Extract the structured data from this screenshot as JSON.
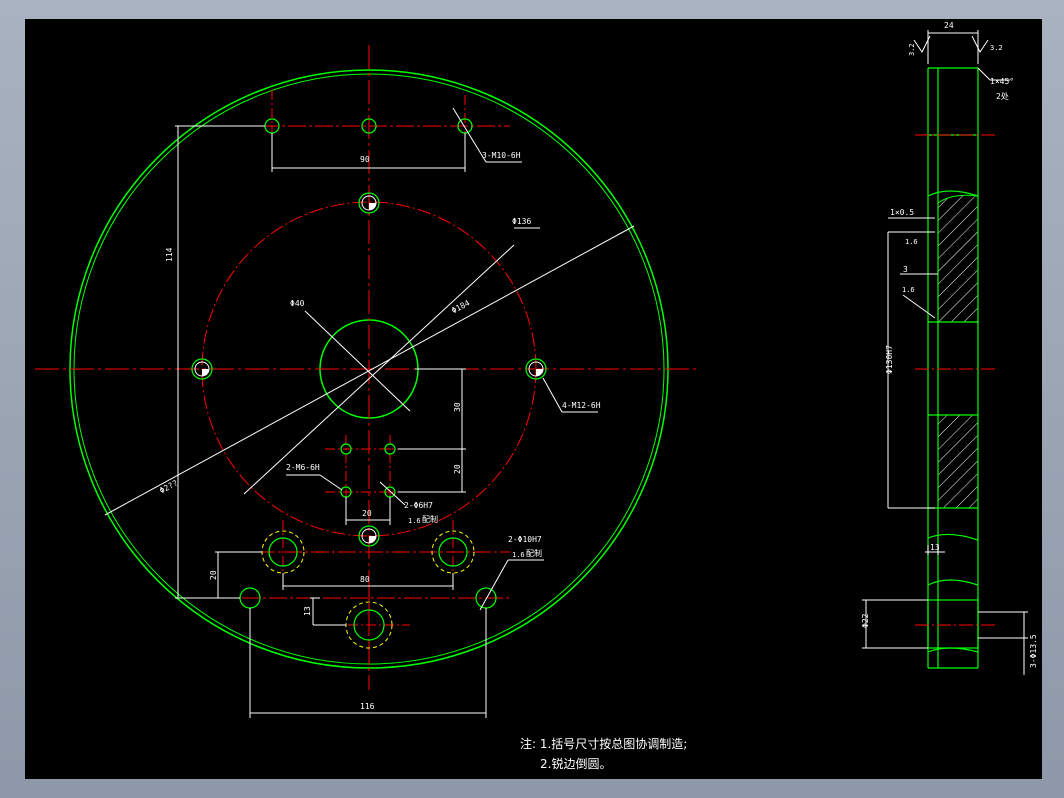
{
  "front_view": {
    "dim_90": "90",
    "dim_114": "114",
    "dim_116": "116",
    "dim_80": "80",
    "dim_20_bottom": "20",
    "dim_20_left": "20",
    "dim_20_mid": "20",
    "dim_30": "30",
    "dim_13": "13",
    "dia_136": "Φ136",
    "dia_40": "Φ40",
    "dia_184": "Φ184",
    "dia_outer": "Φ2??",
    "holes_3xM10": "3-M10-6H",
    "holes_4xM12": "4-M12-6H",
    "holes_2xM6": "2-M6-6H",
    "holes_2xphi6H7": "2-Φ6H7",
    "holes_2xphi10H7": "2-Φ10H7",
    "roughness_1": "1.6",
    "roughness_2": "1.6",
    "match_drill_1": "配制",
    "match_drill_2": "配制"
  },
  "side_view": {
    "dim_24": "24",
    "chamfer": "1×45°",
    "chamfer_count": "2处",
    "fillet": "1×0.5",
    "roughness_a": "1.6",
    "roughness_b": "1.6",
    "dim_3": "3",
    "bore": "Φ130H7",
    "dim_13": "13",
    "dia_22": "Φ22",
    "cb_holes": "3-Φ13.5",
    "rough_top_1": "3.2",
    "rough_top_2": "3.2"
  },
  "notes": {
    "line1": "注: 1.括号尺寸按总图协调制造;",
    "line2": "2.锐边倒圆。"
  },
  "colors": {
    "outline": "#00ff00",
    "centerline": "#ff0000",
    "dimension": "#ffffff",
    "hidden": "#ffff00",
    "background": "#000000"
  }
}
